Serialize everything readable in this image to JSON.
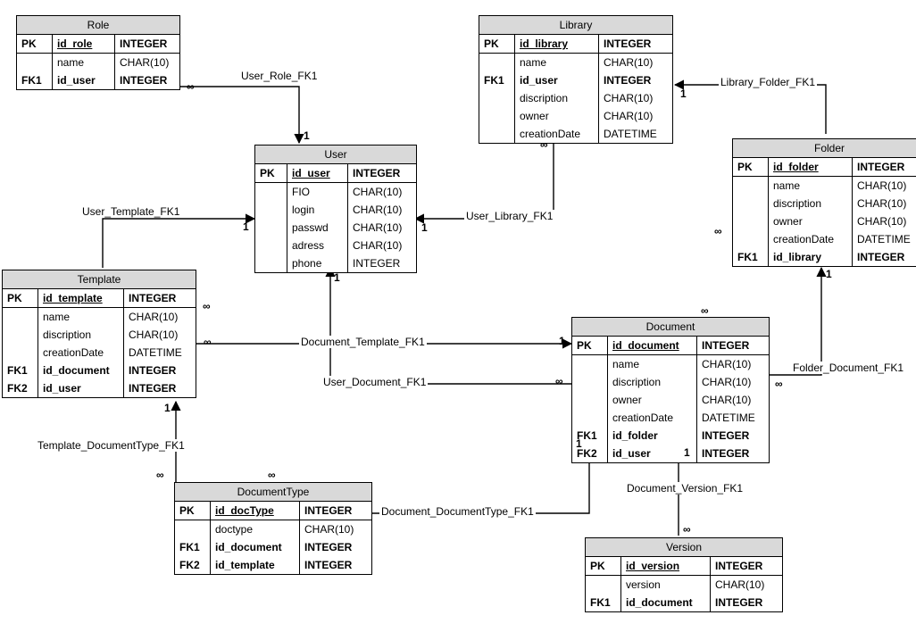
{
  "entities": {
    "role": {
      "title": "Role",
      "pk": {
        "key": "PK",
        "name": "id_role",
        "type": "INTEGER"
      },
      "rows": [
        {
          "key": "",
          "name": "name",
          "type": "CHAR(10)",
          "bold": false
        },
        {
          "key": "FK1",
          "name": "id_user",
          "type": "INTEGER",
          "bold": true
        }
      ]
    },
    "user": {
      "title": "User",
      "pk": {
        "key": "PK",
        "name": "id_user",
        "type": "INTEGER"
      },
      "rows": [
        {
          "key": "",
          "name": "FIO",
          "type": "CHAR(10)",
          "bold": false
        },
        {
          "key": "",
          "name": "login",
          "type": "CHAR(10)",
          "bold": false
        },
        {
          "key": "",
          "name": "passwd",
          "type": "CHAR(10)",
          "bold": false
        },
        {
          "key": "",
          "name": "adress",
          "type": "CHAR(10)",
          "bold": false
        },
        {
          "key": "",
          "name": "phone",
          "type": "INTEGER",
          "bold": false
        }
      ]
    },
    "library": {
      "title": "Library",
      "pk": {
        "key": "PK",
        "name": "id_library",
        "type": "INTEGER"
      },
      "rows": [
        {
          "key": "",
          "name": "name",
          "type": "CHAR(10)",
          "bold": false
        },
        {
          "key": "FK1",
          "name": "id_user",
          "type": "INTEGER",
          "bold": true
        },
        {
          "key": "",
          "name": "discription",
          "type": "CHAR(10)",
          "bold": false
        },
        {
          "key": "",
          "name": "owner",
          "type": "CHAR(10)",
          "bold": false
        },
        {
          "key": "",
          "name": "creationDate",
          "type": "DATETIME",
          "bold": false
        }
      ]
    },
    "folder": {
      "title": "Folder",
      "pk": {
        "key": "PK",
        "name": "id_folder",
        "type": "INTEGER"
      },
      "rows": [
        {
          "key": "",
          "name": "name",
          "type": "CHAR(10)",
          "bold": false
        },
        {
          "key": "",
          "name": "discription",
          "type": "CHAR(10)",
          "bold": false
        },
        {
          "key": "",
          "name": "owner",
          "type": "CHAR(10)",
          "bold": false
        },
        {
          "key": "",
          "name": "creationDate",
          "type": "DATETIME",
          "bold": false
        },
        {
          "key": "FK1",
          "name": "id_library",
          "type": "INTEGER",
          "bold": true
        }
      ]
    },
    "template": {
      "title": "Template",
      "pk": {
        "key": "PK",
        "name": "id_template",
        "type": "INTEGER"
      },
      "rows": [
        {
          "key": "",
          "name": "name",
          "type": "CHAR(10)",
          "bold": false
        },
        {
          "key": "",
          "name": "discription",
          "type": "CHAR(10)",
          "bold": false
        },
        {
          "key": "",
          "name": "creationDate",
          "type": "DATETIME",
          "bold": false
        },
        {
          "key": "FK1",
          "name": "id_document",
          "type": "INTEGER",
          "bold": true
        },
        {
          "key": "FK2",
          "name": "id_user",
          "type": "INTEGER",
          "bold": true
        }
      ]
    },
    "document": {
      "title": "Document",
      "pk": {
        "key": "PK",
        "name": "id_document",
        "type": "INTEGER"
      },
      "rows": [
        {
          "key": "",
          "name": "name",
          "type": "CHAR(10)",
          "bold": false
        },
        {
          "key": "",
          "name": "discription",
          "type": "CHAR(10)",
          "bold": false
        },
        {
          "key": "",
          "name": "owner",
          "type": "CHAR(10)",
          "bold": false
        },
        {
          "key": "",
          "name": "creationDate",
          "type": "DATETIME",
          "bold": false
        },
        {
          "key": "FK1",
          "name": "id_folder",
          "type": "INTEGER",
          "bold": true
        },
        {
          "key": "FK2",
          "name": "id_user",
          "type": "INTEGER",
          "bold": true
        }
      ]
    },
    "documentType": {
      "title": "DocumentType",
      "pk": {
        "key": "PK",
        "name": "id_docType",
        "type": "INTEGER"
      },
      "rows": [
        {
          "key": "",
          "name": "doctype",
          "type": "CHAR(10)",
          "bold": false
        },
        {
          "key": "FK1",
          "name": "id_document",
          "type": "INTEGER",
          "bold": true
        },
        {
          "key": "FK2",
          "name": "id_template",
          "type": "INTEGER",
          "bold": true
        }
      ]
    },
    "version": {
      "title": "Version",
      "pk": {
        "key": "PK",
        "name": "id_version",
        "type": "INTEGER"
      },
      "rows": [
        {
          "key": "",
          "name": "version",
          "type": "CHAR(10)",
          "bold": false
        },
        {
          "key": "FK1",
          "name": "id_document",
          "type": "INTEGER",
          "bold": true
        }
      ]
    }
  },
  "labels": {
    "userRole": "User_Role_FK1",
    "userTemplate": "User_Template_FK1",
    "userLibrary": "User_Library_FK1",
    "libraryFolder": "Library_Folder_FK1",
    "docTemplate": "Document_Template_FK1",
    "userDocument": "User_Document_FK1",
    "folderDocument": "Folder_Document_FK1",
    "templateDocType": "Template_DocumentType_FK1",
    "docDocType": "Document_DocumentType_FK1",
    "docVersion": "Document_Version_FK1"
  },
  "card": {
    "one": "1",
    "many": "∞"
  }
}
